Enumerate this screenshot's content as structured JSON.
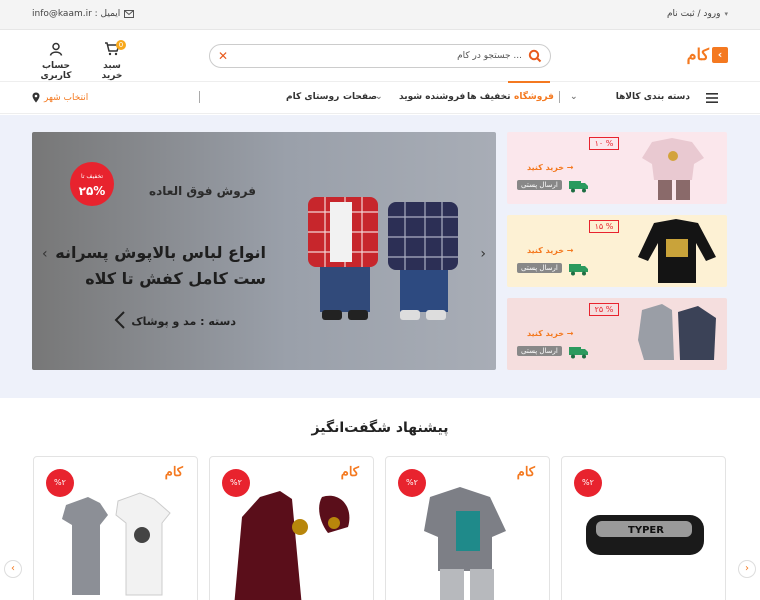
{
  "topbar": {
    "email": "info@kaam.ir : ایمیل",
    "login": "ورود / ثبت نام"
  },
  "header": {
    "logo_text": "کام",
    "search_placeholder": "جستجو در کام ...",
    "cart_label": "سبد خرید",
    "cart_count": "0",
    "account_label": "حساب کاربری"
  },
  "nav": {
    "categories": "دسته بندی کالاها",
    "items": [
      "فروشگاه",
      "تخفیف ها",
      "فروشنده شوید",
      "صفحات",
      "روستای کام"
    ],
    "city": "انتخاب شهر"
  },
  "slider": {
    "badge_top": "تخفیف تا",
    "badge_value": "۲۵%",
    "subtitle": "فروش فوق العاده",
    "title_line1": "انواع لباس بالاپوش پسرانه",
    "title_line2": "ست کامل کفش تا کلاه",
    "category": "دسته : مد و پوشاک"
  },
  "promos": [
    {
      "percent": "۱۰ %",
      "buy": "خرید کنید",
      "ship": "ارسال پستی",
      "bg": "#fbe7ec"
    },
    {
      "percent": "۱۵ %",
      "buy": "خرید کنید",
      "ship": "ارسال پستی",
      "bg": "#fdf1d4"
    },
    {
      "percent": "۲۵ %",
      "buy": "خرید کنید",
      "ship": "ارسال پستی",
      "bg": "#f5dede"
    }
  ],
  "offers": {
    "title": "پیشنهاد شگفت‌انگیز",
    "cards": [
      {
        "discount": "%۲",
        "logo": "کام"
      },
      {
        "discount": "%۲",
        "logo": "کام"
      },
      {
        "discount": "%۲",
        "logo": "کام"
      },
      {
        "discount": "%۲",
        "logo": ""
      }
    ]
  },
  "colors": {
    "accent": "#f47920",
    "badge_red": "#e8232e",
    "hero_bg": "#eef1fa"
  }
}
